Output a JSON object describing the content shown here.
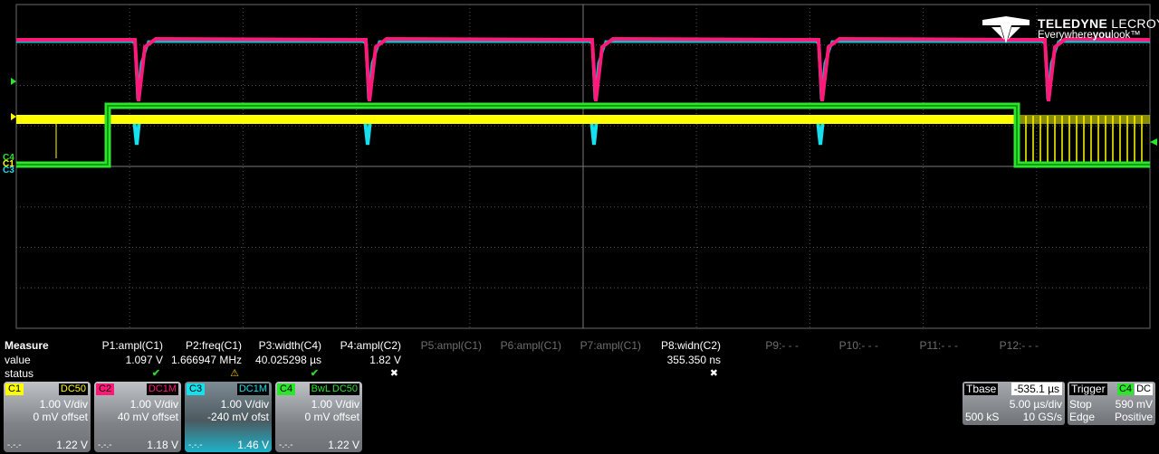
{
  "logo": {
    "brand_bold": "TELEDYNE",
    "brand_rest": "LECROY",
    "tag_pre": "Everywhere",
    "tag_bold": "you",
    "tag_post": "look™"
  },
  "colors": {
    "c1": "#ffff00",
    "c2": "#ff1a7a",
    "c3": "#14e0ee",
    "c4": "#2ee52e",
    "grid": "#505050"
  },
  "channel_markers": {
    "c4": "C4",
    "c1": "C1",
    "c3": "C3"
  },
  "measure": {
    "title": "Measure",
    "row_labels": {
      "value": "value",
      "status": "status"
    },
    "params": [
      {
        "label": "P1:ampl(C1)",
        "value": "1.097 V",
        "status": "ok"
      },
      {
        "label": "P2:freq(C1)",
        "value": "1.666947 MHz",
        "status": "warn"
      },
      {
        "label": "P3:width(C4)",
        "value": "40.025298 µs",
        "status": "ok"
      },
      {
        "label": "P4:ampl(C2)",
        "value": "1.82 V",
        "status": "x"
      },
      {
        "label": "P5:ampl(C1)",
        "value": "",
        "status": ""
      },
      {
        "label": "P6:ampl(C1)",
        "value": "",
        "status": ""
      },
      {
        "label": "P7:ampl(C1)",
        "value": "",
        "status": ""
      },
      {
        "label": "P8:widn(C2)",
        "value": "355.350 ns",
        "status": "x"
      },
      {
        "label": "P9:- - -",
        "value": "",
        "status": ""
      },
      {
        "label": "P10:- - -",
        "value": "",
        "status": ""
      },
      {
        "label": "P11:- - -",
        "value": "",
        "status": ""
      },
      {
        "label": "P12:- - -",
        "value": "",
        "status": ""
      }
    ],
    "status_glyphs": {
      "ok": "✔",
      "warn": "⚠",
      "x": "✖"
    }
  },
  "channels": [
    {
      "id": "C1",
      "tags": [
        "DC50"
      ],
      "vdiv": "1.00 V/div",
      "offset": "0 mV offset",
      "dash": "-.-.-",
      "level": "1.22 V"
    },
    {
      "id": "C2",
      "tags": [
        "DC1M"
      ],
      "vdiv": "1.00 V/div",
      "offset": "40 mV offset",
      "dash": "-.-.-",
      "level": "1.18 V"
    },
    {
      "id": "C3",
      "tags": [
        "DC1M"
      ],
      "vdiv": "1.00 V/div",
      "offset": "-240 mV ofst",
      "dash": "-.-.-",
      "level": "1.46 V"
    },
    {
      "id": "C4",
      "tags": [
        "BwL",
        "DC50"
      ],
      "vdiv": "1.00 V/div",
      "offset": "0 mV offset",
      "dash": "-.-.-",
      "level": "1.22 V"
    }
  ],
  "tbase": {
    "title": "Tbase",
    "delay": "-535.1 µs",
    "per_div": "5.00 µs/div",
    "samples": "500 kS",
    "rate": "10 GS/s"
  },
  "trigger": {
    "title": "Trigger",
    "source": "C4",
    "coupling": "DC",
    "mode": "Stop",
    "level": "590 mV",
    "type": "Edge",
    "slope": "Positive"
  }
}
